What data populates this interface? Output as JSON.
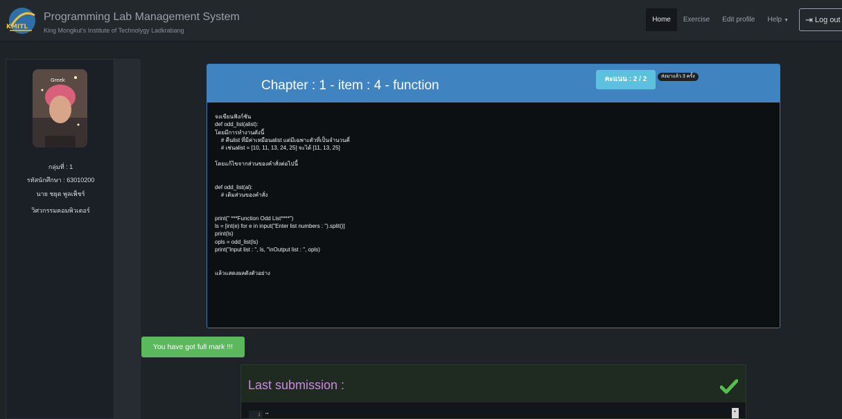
{
  "header": {
    "title": "Programming Lab Management System",
    "subtitle": "King Mongkut's Institute of Technolygy Ladkrabang",
    "logo_text": "KMITL",
    "nav": {
      "home": "Home",
      "exercise": "Exercise",
      "edit_profile": "Edit profile",
      "help": "Help",
      "logout": "Log out"
    }
  },
  "sidebar": {
    "avatar_caption": "Greek",
    "group": "กลุ่มที่ : 1",
    "student_id": "รหัสนักศึกษา : 63010200",
    "name": "นาย ชยุต พูลเพ็ชร์",
    "department": "วิศวกรรมคอมพิวเตอร์"
  },
  "problem": {
    "title": "Chapter : 1 - item : 4 - function",
    "score": "คะแนน : 2 / 2",
    "sent_count": "ส่งมาแล้ว 3 ครั้ง",
    "body": "จงเขียนฟังก์ชัน\ndef odd_list(alist):\nโดยมีการทำงานดังนี้\n    # คืนlist ที่มีค่าเหมือนalist แต่มีเฉพาะตัวที่เป็นจำนวนคี่\n    # เช่นalist = [10, 11, 13, 24, 25] จะได้ [11, 13, 25]\n\nโดยแก้ไขจากส่วนของคำสั่งต่อไปนี้\n\n\ndef odd_list(al):\n    # เติมส่วนของคำสั่ง\n\n\nprint(\" ***Function Odd List****\")\nls = [int(e) for e in input(\"Enter list numbers : \").split()]\nprint(ls)\nopls = odd_list(ls)\nprint(\"Input list : \", ls, \"\\nOutput list : \", opls)\n\n\nแล้วแสดงผลดังตัวอย่าง"
  },
  "result": {
    "message": "You have got full mark !!!"
  },
  "submission": {
    "title": "Last submission :",
    "line_number": "1",
    "first_line": "'''"
  },
  "colors": {
    "header_blue": "#3f83c1",
    "success_green": "#5cb85c",
    "score_teal": "#5cc0de",
    "submission_purple": "#c98be0"
  }
}
